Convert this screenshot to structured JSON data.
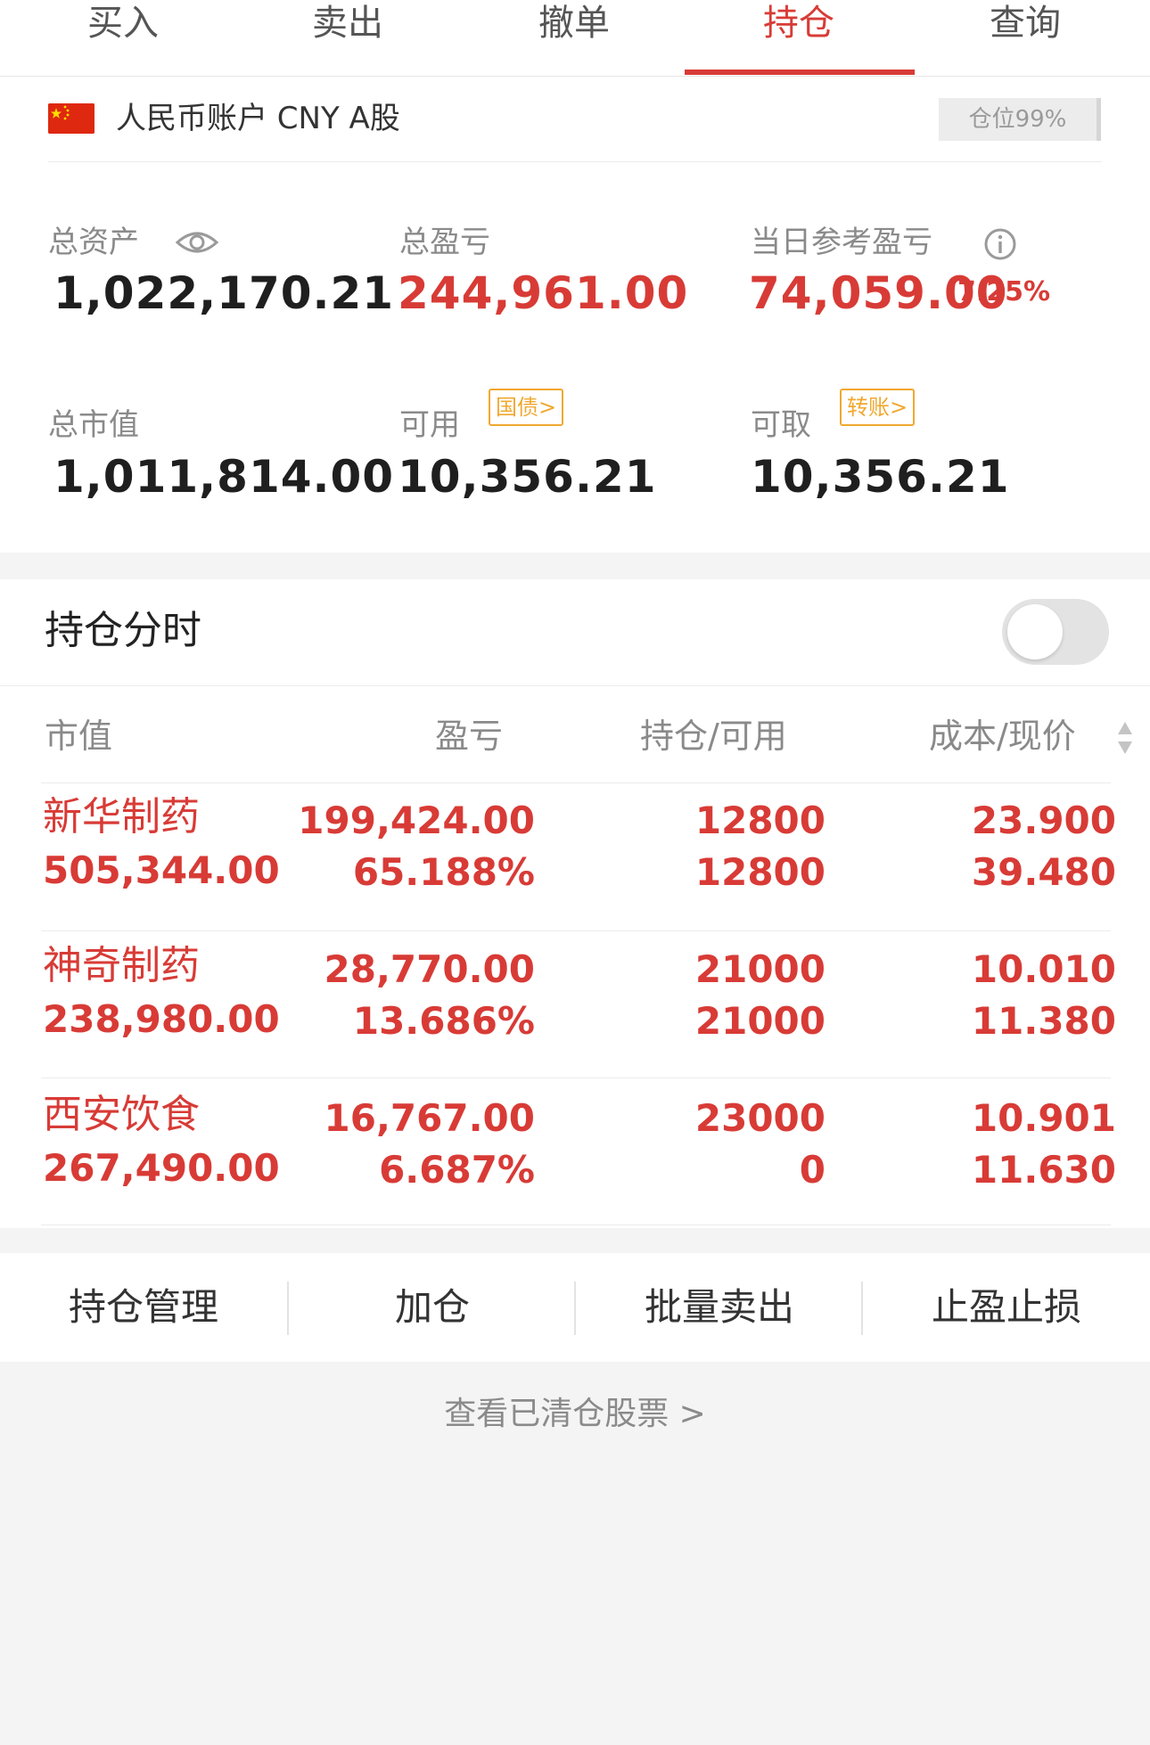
{
  "tabs": [
    {
      "label": "买入",
      "active": false
    },
    {
      "label": "卖出",
      "active": false
    },
    {
      "label": "撤单",
      "active": false
    },
    {
      "label": "持仓",
      "active": true
    },
    {
      "label": "查询",
      "active": false
    }
  ],
  "account": {
    "flag_icon": "china-flag-icon",
    "name": "人民币账户 CNY A股",
    "position_ratio": "仓位99%",
    "total_assets_label": "总资产",
    "total_assets": "1,022,170.21",
    "total_pl_label": "总盈亏",
    "total_pl": "244,961.00",
    "daily_pl_label": "当日参考盈亏",
    "daily_pl": "74,059.00",
    "daily_pl_pct": "7.25%",
    "market_value_label": "总市值",
    "market_value": "1,011,814.00",
    "available_label": "可用",
    "available": "10,356.21",
    "available_tag": "国债>",
    "withdrawable_label": "可取",
    "withdrawable": "10,356.21",
    "withdrawable_tag": "转账>"
  },
  "intraday": {
    "title": "持仓分时",
    "toggle_on": false
  },
  "table": {
    "headers": {
      "market_value": "市值",
      "pl": "盈亏",
      "position": "持仓/可用",
      "cost_price": "成本/现价"
    },
    "rows": [
      {
        "name": "新华制药",
        "market_value": "505,344.00",
        "pl": "199,424.00",
        "pl_pct": "65.188%",
        "position": "12800",
        "available": "12800",
        "cost": "23.900",
        "price": "39.480"
      },
      {
        "name": "神奇制药",
        "market_value": "238,980.00",
        "pl": "28,770.00",
        "pl_pct": "13.686%",
        "position": "21000",
        "available": "21000",
        "cost": "10.010",
        "price": "11.380"
      },
      {
        "name": "西安饮食",
        "market_value": "267,490.00",
        "pl": "16,767.00",
        "pl_pct": "6.687%",
        "position": "23000",
        "available": "0",
        "cost": "10.901",
        "price": "11.630"
      }
    ]
  },
  "actions": [
    "持仓管理",
    "加仓",
    "批量卖出",
    "止盈止损"
  ],
  "cleared_link": "查看已清仓股票 >",
  "colors": {
    "accent_red": "#d83b36",
    "tag_orange": "#f0a830"
  }
}
